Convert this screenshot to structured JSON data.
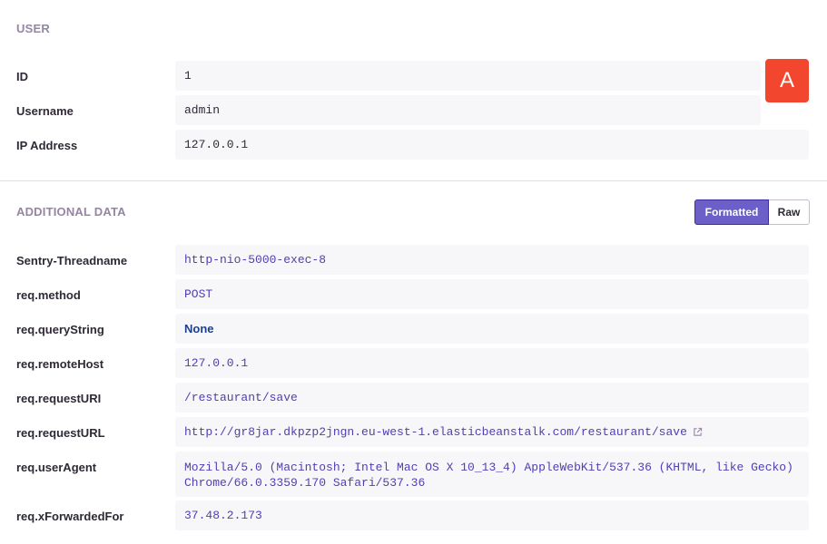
{
  "user": {
    "title": "USER",
    "avatar_letter": "A",
    "fields": [
      {
        "key": "ID",
        "value": "1"
      },
      {
        "key": "Username",
        "value": "admin"
      },
      {
        "key": "IP Address",
        "value": "127.0.0.1"
      }
    ]
  },
  "additional": {
    "title": "ADDITIONAL DATA",
    "toggle": {
      "formatted": "Formatted",
      "raw": "Raw",
      "selected": "Formatted"
    },
    "fields": [
      {
        "key": "Sentry-Threadname",
        "value": "http-nio-5000-exec-8"
      },
      {
        "key": "req.method",
        "value": "POST"
      },
      {
        "key": "req.queryString",
        "value": "None"
      },
      {
        "key": "req.remoteHost",
        "value": "127.0.0.1"
      },
      {
        "key": "req.requestURI",
        "value": "/restaurant/save"
      },
      {
        "key": "req.requestURL",
        "value": "http://gr8jar.dkpzp2jngn.eu-west-1.elasticbeanstalk.com/restaurant/save"
      },
      {
        "key": "req.userAgent",
        "value_line1": "Mozilla/5.0 (Macintosh; Intel Mac OS X 10_13_4) AppleWebKit/537.36 (KHTML, like Gecko)",
        "value_line2": "Chrome/66.0.3359.170 Safari/537.36"
      },
      {
        "key": "req.xForwardedFor",
        "value": "37.48.2.173"
      }
    ]
  },
  "colors": {
    "accent": "#6c5fc7",
    "avatar": "#f2462f",
    "value_text": "#4e3fb4"
  }
}
